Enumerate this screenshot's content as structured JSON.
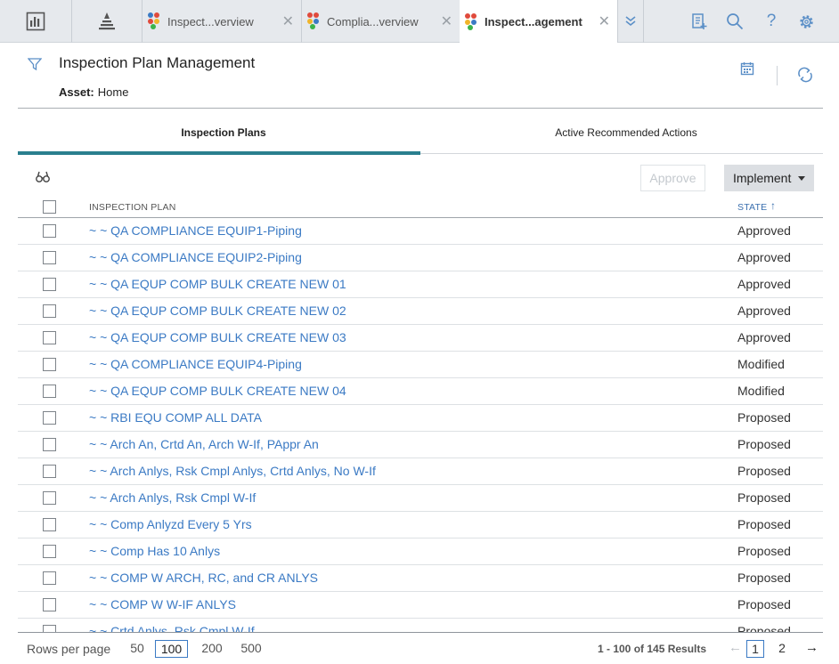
{
  "tabs": [
    {
      "label": "Inspect...verview",
      "active": false
    },
    {
      "label": "Complia...verview",
      "active": false
    },
    {
      "label": "Inspect...agement",
      "active": true
    }
  ],
  "icons": {
    "dashboard": "dashboard-icon",
    "hierarchy": "asset-hierarchy-icon",
    "overflow": "chevron-double-down-icon",
    "report": "report-add-icon",
    "search": "search-icon",
    "help": "help-icon",
    "settings": "gear-icon"
  },
  "colors": {
    "accent": "#2a7f8e",
    "link": "#3b7ac4",
    "icon": "#5b8fc7"
  },
  "header": {
    "title": "Inspection Plan Management",
    "asset_label": "Asset:",
    "asset_value": "Home"
  },
  "subtabs": [
    {
      "label": "Inspection Plans",
      "active": true
    },
    {
      "label": "Active Recommended Actions",
      "active": false
    }
  ],
  "toolbar": {
    "approve_label": "Approve",
    "implement_label": "Implement"
  },
  "table": {
    "columns": {
      "plan": "INSPECTION PLAN",
      "state": "STATE"
    },
    "sort": {
      "column": "STATE",
      "direction": "ascending"
    },
    "rows": [
      {
        "plan": "~ ~ QA COMPLIANCE EQUIP1-Piping",
        "state": "Approved"
      },
      {
        "plan": "~ ~ QA COMPLIANCE EQUIP2-Piping",
        "state": "Approved"
      },
      {
        "plan": "~ ~ QA EQUP COMP BULK CREATE NEW 01",
        "state": "Approved"
      },
      {
        "plan": "~ ~ QA EQUP COMP BULK CREATE NEW 02",
        "state": "Approved"
      },
      {
        "plan": "~ ~ QA EQUP COMP BULK CREATE NEW 03",
        "state": "Approved"
      },
      {
        "plan": "~ ~ QA COMPLIANCE EQUIP4-Piping",
        "state": "Modified"
      },
      {
        "plan": "~ ~ QA EQUP COMP BULK CREATE NEW 04",
        "state": "Modified"
      },
      {
        "plan": "~ ~ RBI EQU COMP ALL DATA",
        "state": "Proposed"
      },
      {
        "plan": "~ ~ Arch An, Crtd An, Arch W-If, PAppr An",
        "state": "Proposed"
      },
      {
        "plan": "~ ~ Arch Anlys, Rsk Cmpl Anlys, Crtd Anlys, No W-If",
        "state": "Proposed"
      },
      {
        "plan": "~ ~ Arch Anlys, Rsk Cmpl W-If",
        "state": "Proposed"
      },
      {
        "plan": "~ ~ Comp Anlyzd Every 5 Yrs",
        "state": "Proposed"
      },
      {
        "plan": "~ ~ Comp Has 10 Anlys",
        "state": "Proposed"
      },
      {
        "plan": "~ ~ COMP W ARCH, RC, and CR ANLYS",
        "state": "Proposed"
      },
      {
        "plan": "~ ~ COMP W W-IF ANLYS",
        "state": "Proposed"
      },
      {
        "plan": "~ ~ Crtd Anlys, Rsk Cmpl W-If",
        "state": "Proposed"
      }
    ]
  },
  "footer": {
    "rows_per_page_label": "Rows per page",
    "options": [
      "50",
      "100",
      "200",
      "500"
    ],
    "selected_option": "100",
    "results": "1 - 100 of 145 Results",
    "pages": [
      "1",
      "2"
    ],
    "current_page": "1"
  }
}
